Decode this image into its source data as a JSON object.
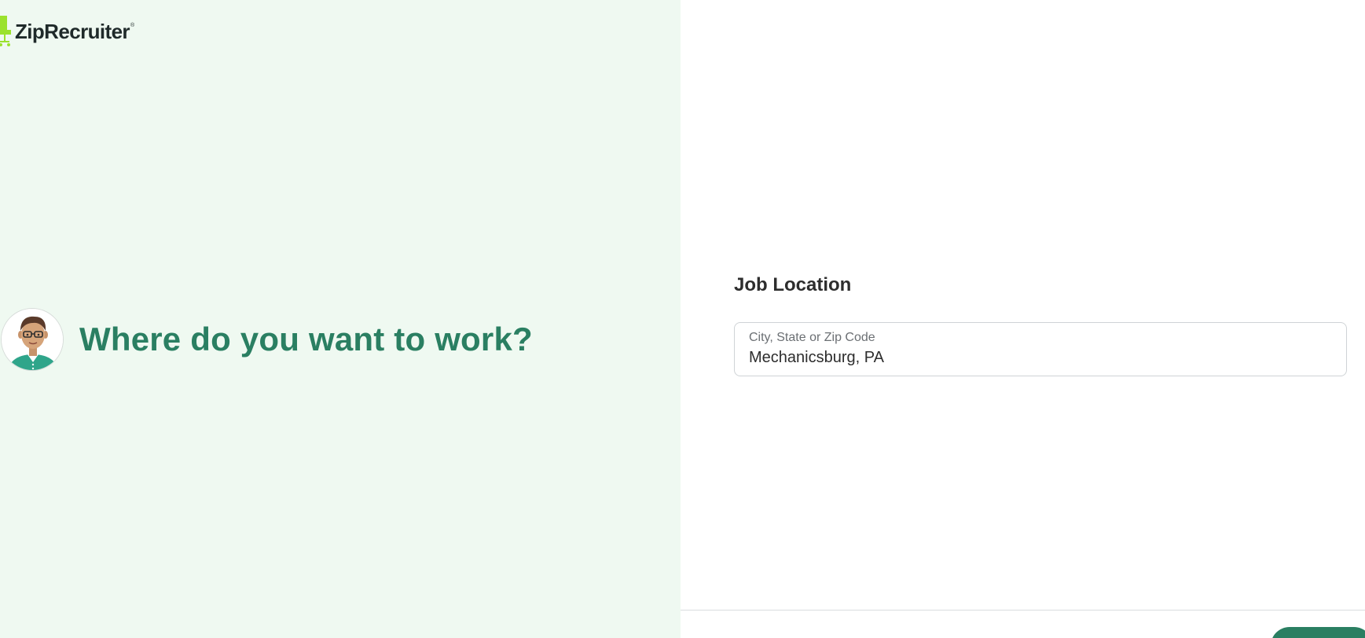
{
  "brand": {
    "name": "ZipRecruiter",
    "registered_mark": "®",
    "logo_icon": "chair-logo-icon",
    "logo_color": "#9be22d"
  },
  "hero": {
    "title": "Where do you want to work?",
    "avatar_icon": "person-avatar-icon",
    "title_color": "#2a7f62",
    "background_color": "#eff9f1"
  },
  "form": {
    "section_title": "Job Location",
    "location_field": {
      "label": "City, State or Zip Code",
      "value": "Mechanicsburg, PA"
    }
  },
  "footer": {
    "button_color": "#2a7f62"
  }
}
